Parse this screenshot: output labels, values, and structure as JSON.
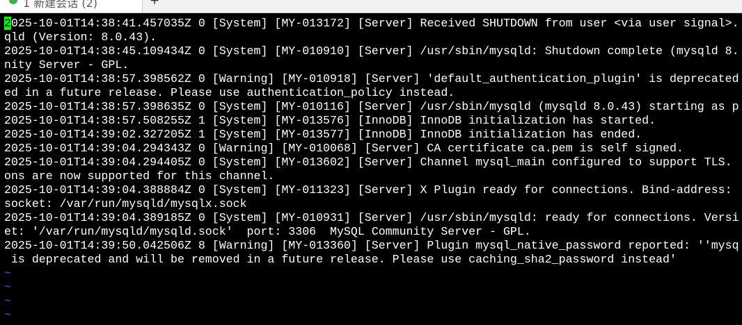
{
  "tab": {
    "label": "1 新建会话 (2)",
    "new_tab": "+"
  },
  "terminal": {
    "cursor_char": "2",
    "first_line_rest": "025-10-01T14:38:41.457035Z 0 [System] [MY-013172] [Server] Received SHUTDOWN from user <via user signal>.",
    "lines": [
      "qld (Version: 8.0.43).",
      "2025-10-01T14:38:45.109434Z 0 [System] [MY-010910] [Server] /usr/sbin/mysqld: Shutdown complete (mysqld 8.",
      "nity Server - GPL.",
      "2025-10-01T14:38:57.398562Z 0 [Warning] [MY-010918] [Server] 'default_authentication_plugin' is deprecated",
      "ed in a future release. Please use authentication_policy instead.",
      "2025-10-01T14:38:57.398635Z 0 [System] [MY-010116] [Server] /usr/sbin/mysqld (mysqld 8.0.43) starting as p",
      "2025-10-01T14:38:57.508255Z 1 [System] [MY-013576] [InnoDB] InnoDB initialization has started.",
      "2025-10-01T14:39:02.327205Z 1 [System] [MY-013577] [InnoDB] InnoDB initialization has ended.",
      "2025-10-01T14:39:04.294343Z 0 [Warning] [MY-010068] [Server] CA certificate ca.pem is self signed.",
      "2025-10-01T14:39:04.294405Z 0 [System] [MY-013602] [Server] Channel mysql_main configured to support TLS.",
      "ons are now supported for this channel.",
      "2025-10-01T14:39:04.388884Z 0 [System] [MY-011323] [Server] X Plugin ready for connections. Bind-address:",
      "socket: /var/run/mysqld/mysqlx.sock",
      "2025-10-01T14:39:04.389185Z 0 [System] [MY-010931] [Server] /usr/sbin/mysqld: ready for connections. Versi",
      "et: '/var/run/mysqld/mysqld.sock'  port: 3306  MySQL Community Server - GPL.",
      "2025-10-01T14:39:50.042506Z 8 [Warning] [MY-013360] [Server] Plugin mysql_native_password reported: ''mysq",
      " is deprecated and will be removed in a future release. Please use caching_sha2_password instead'"
    ],
    "tildes": [
      "~",
      "~",
      "~",
      "~"
    ]
  },
  "colors": {
    "background": "#000000",
    "text": "#ffffff",
    "cursor": "#00ff00",
    "tilde": "#2f5fff",
    "tab_status": "#2fb84a"
  }
}
